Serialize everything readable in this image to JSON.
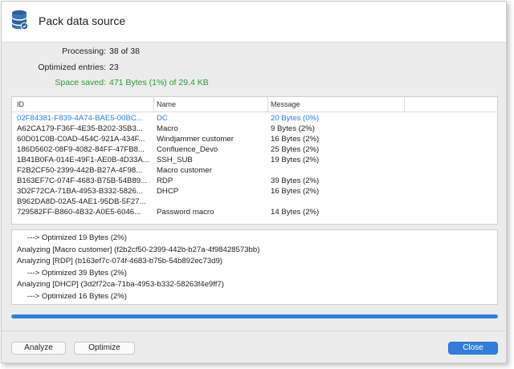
{
  "window": {
    "title": "Pack data source",
    "icon": "database-icon"
  },
  "summary": {
    "processing_label": "Processing:",
    "processing_value": "38 of 38",
    "optimized_label": "Optimized entries:",
    "optimized_value": "23",
    "space_label": "Space saved:",
    "space_value": "471 Bytes (1%) of 29.4 KB"
  },
  "table": {
    "headers": {
      "id": "ID",
      "name": "Name",
      "message": "Message"
    },
    "rows": [
      {
        "id": "02F84381-F839-4A74-BAE5-00BC...",
        "name": "DC",
        "message": "20 Bytes (0%)",
        "selected": true
      },
      {
        "id": "A62CA179-F36F-4E35-B202-35B3...",
        "name": "Macro",
        "message": "9 Bytes (2%)"
      },
      {
        "id": "60D01C0B-C0AD-454C-921A-434F...",
        "name": "Windjammer customer",
        "message": "16 Bytes (2%)"
      },
      {
        "id": "186D5602-08F9-4082-84FF-47FB8...",
        "name": "Confluence_Devo",
        "message": "25 Bytes (2%)"
      },
      {
        "id": "1B41B0FA-014E-49F1-AE0B-4D33A...",
        "name": "SSH_SUB",
        "message": "19 Bytes (2%)"
      },
      {
        "id": "F2B2CF50-2399-442B-B27A-4F98...",
        "name": "Macro customer",
        "message": ""
      },
      {
        "id": "B163EF7C-074F-4683-B75B-54B89...",
        "name": "RDP",
        "message": "39 Bytes (2%)"
      },
      {
        "id": "3D2F72CA-71BA-4953-B332-5826...",
        "name": "DHCP",
        "message": "16 Bytes (2%)"
      },
      {
        "id": "B962DA8D-02A5-4AE1-95DB-5F27...",
        "name": "",
        "message": ""
      },
      {
        "id": "729582FF-B860-4B32-A0E5-6046...",
        "name": "Password macro",
        "message": "14 Bytes (2%)"
      }
    ]
  },
  "log": {
    "lines": [
      {
        "text": "---> Optimized 19 Bytes (2%)",
        "indent": true
      },
      {
        "text": "Analyzing [Macro customer] (f2b2cf50-2399-442b-b27a-4f98428573bb)",
        "indent": false
      },
      {
        "text": "Analyzing [RDP] (b163ef7c-074f-4683-b75b-54b892ec73d9)",
        "indent": false
      },
      {
        "text": "---> Optimized 39 Bytes (2%)",
        "indent": true
      },
      {
        "text": "Analyzing [DHCP] (3d2f72ca-71ba-4953-b332-58263f4e9ff7)",
        "indent": false
      },
      {
        "text": "---> Optimized 16 Bytes (2%)",
        "indent": true
      }
    ]
  },
  "progress": {
    "fraction": 1.0
  },
  "buttons": {
    "analyze": "Analyze",
    "optimize": "Optimize",
    "close": "Close"
  },
  "colors": {
    "accent": "#2f7fdb",
    "success": "#2a9a3a"
  }
}
